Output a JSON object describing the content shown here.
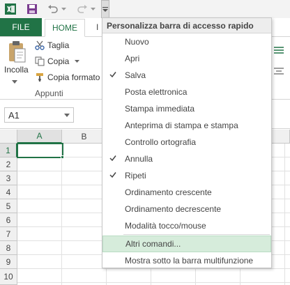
{
  "qat": {
    "icons": [
      "excel-icon",
      "save-icon",
      "undo-icon",
      "redo-icon",
      "customize-dropdown-icon"
    ]
  },
  "tabs": {
    "file": "FILE",
    "home": "HOME",
    "next_partial": "I"
  },
  "ribbon": {
    "paste_label": "Incolla",
    "cut_label": "Taglia",
    "copy_label": "Copia",
    "format_painter_label": "Copia formato",
    "group_label": "Appunti"
  },
  "namebox": {
    "value": "A1"
  },
  "grid": {
    "columns": [
      "A",
      "B"
    ],
    "rows": [
      "1",
      "2",
      "3",
      "4",
      "5",
      "6",
      "7",
      "8",
      "9",
      "10"
    ],
    "selected_cell": "A1"
  },
  "menu": {
    "title": "Personalizza barra di accesso rapido",
    "items": [
      {
        "label": "Nuovo",
        "checked": false
      },
      {
        "label": "Apri",
        "checked": false
      },
      {
        "label": "Salva",
        "checked": true
      },
      {
        "label": "Posta elettronica",
        "checked": false
      },
      {
        "label": "Stampa immediata",
        "checked": false
      },
      {
        "label": "Anteprima di stampa e stampa",
        "checked": false
      },
      {
        "label": "Controllo ortografia",
        "checked": false
      },
      {
        "label": "Annulla",
        "checked": true
      },
      {
        "label": "Ripeti",
        "checked": true
      },
      {
        "label": "Ordinamento crescente",
        "checked": false
      },
      {
        "label": "Ordinamento decrescente",
        "checked": false
      },
      {
        "label": "Modalità tocco/mouse",
        "checked": false
      }
    ],
    "more_commands": "Altri comandi...",
    "show_below": "Mostra sotto la barra multifunzione"
  },
  "colors": {
    "accent": "#217346",
    "hover": "#d6ecdb"
  }
}
